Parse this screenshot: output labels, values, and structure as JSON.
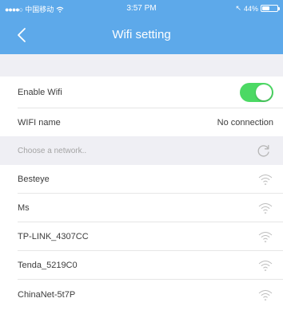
{
  "status_bar": {
    "carrier": "中国移动",
    "time": "3:57 PM",
    "battery_percent": "44%"
  },
  "nav": {
    "title": "Wifi setting"
  },
  "settings": {
    "enable_wifi_label": "Enable Wifi",
    "enable_wifi_on": true,
    "wifi_name_label": "WIFI name",
    "wifi_name_value": "No connection"
  },
  "network_list": {
    "header": "Choose a network..",
    "networks": [
      {
        "ssid": "Besteye"
      },
      {
        "ssid": "Ms"
      },
      {
        "ssid": "TP-LINK_4307CC"
      },
      {
        "ssid": "Tenda_5219C0"
      },
      {
        "ssid": "ChinaNet-5t7P"
      }
    ]
  },
  "colors": {
    "accent": "#5da9ea",
    "toggle_on": "#4cd964",
    "section_bg": "#efeff4"
  },
  "icons": {
    "back": "chevron-left-icon",
    "refresh": "refresh-icon",
    "wifi": "wifi-icon",
    "signal": "signal-dots-icon",
    "battery": "battery-icon"
  }
}
